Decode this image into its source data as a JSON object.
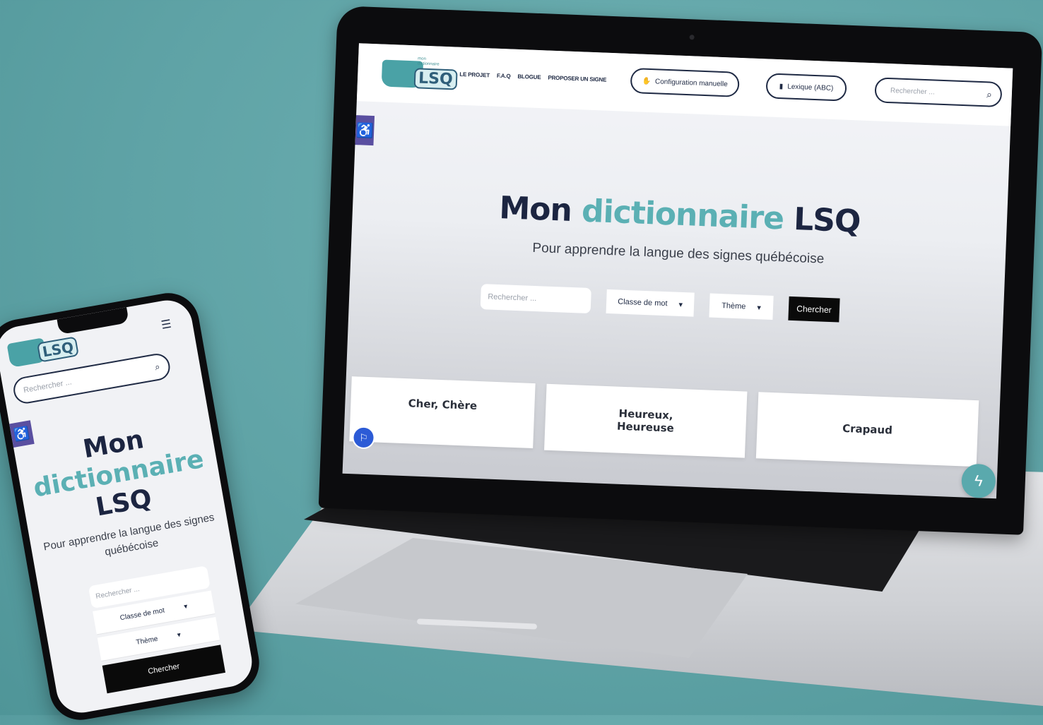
{
  "colors": {
    "background": "#5fa3a6",
    "accent": "#5bb0b4",
    "navy": "#1c2541",
    "a11y": "#5a4fa0",
    "button": "#0a0a0a"
  },
  "logo": {
    "mon": "mon",
    "dictionnaire": "dictionnaire",
    "lsq": "LSQ"
  },
  "laptop": {
    "nav": [
      "LE PROJET",
      "F.A.Q",
      "BLOGUE",
      "PROPOSER UN SIGNE"
    ],
    "config_label": "Configuration manuelle",
    "config_icon": "hand-icon",
    "lexique_label": "Lexique (ABC)",
    "lexique_icon": "book-icon",
    "header_search_placeholder": "Rechercher ...",
    "title_part1": "Mon",
    "title_accent": "dictionnaire",
    "title_part2": "LSQ",
    "subtitle": "Pour apprendre la langue des signes québécoise",
    "search_placeholder": "Rechercher ...",
    "select_classe": "Classe de mot",
    "select_theme": "Thème",
    "search_button": "Chercher",
    "cards": [
      "Cher, Chère",
      "Heureux,\nHeureuse",
      "Crapaud"
    ]
  },
  "phone": {
    "search_placeholder": "Rechercher ...",
    "title_part1": "Mon",
    "title_accent": "dictionnaire",
    "title_part2": "LSQ",
    "subtitle": "Pour apprendre la langue des signes québécoise",
    "input_placeholder": "Rechercher ...",
    "select_classe": "Classe de mot",
    "select_theme": "Thème",
    "search_button": "Chercher"
  }
}
